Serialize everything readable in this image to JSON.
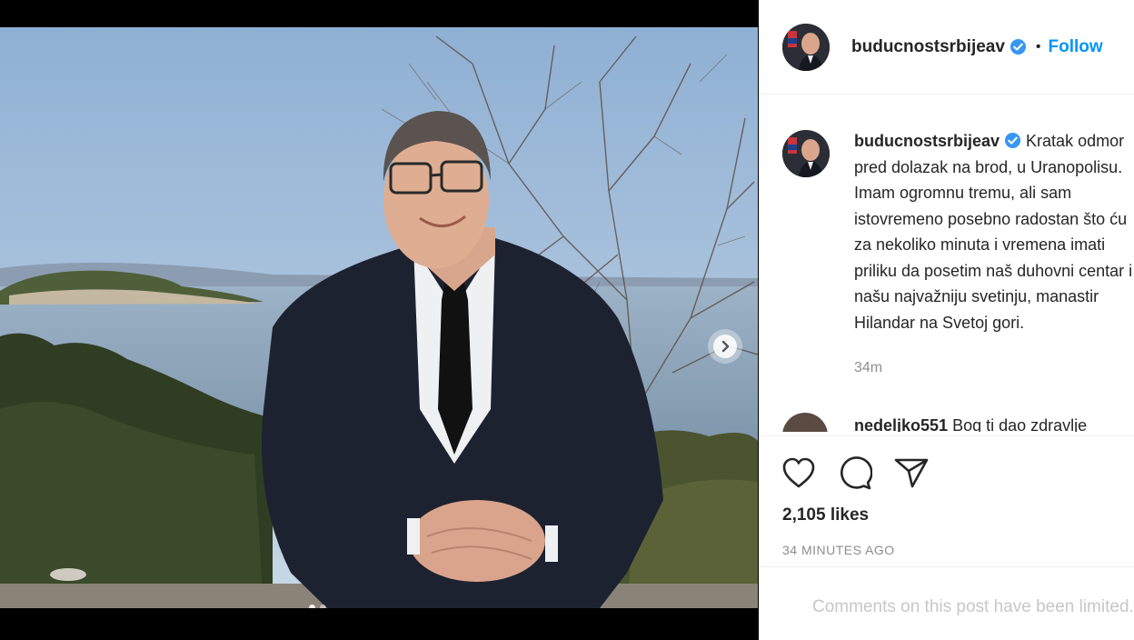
{
  "post": {
    "username": "buducnostsrbijeav",
    "follow_label": "Follow",
    "separator": "•",
    "caption": "Kratak odmor pred dolazak na brod, u Uranopolisu. Imam ogromnu tremu, ali sam istovremeno posebno radostan što ću za nekoliko minuta i vremena imati priliku da posetim naš duhovni centar i našu najvažniju svetinju, manastir Hilandar na Svetoj gori.",
    "time_ago": "34m",
    "likes": "2,105 likes",
    "posted": "34 MINUTES AGO",
    "comments_disabled": "Comments on this post have been limited."
  },
  "comment": {
    "username": "nedeljko551",
    "text": "Bog ti dao zdravlje"
  },
  "carousel": {
    "slide_count": 2,
    "active_index": 0
  },
  "icons": {
    "verified": "verified-badge-icon",
    "next": "chevron-right-icon",
    "like": "heart-icon",
    "comment": "comment-bubble-icon",
    "share": "paper-plane-icon"
  },
  "colors": {
    "link_blue": "#0095f6",
    "verified_blue": "#3897f0",
    "muted": "#8e8e8e",
    "disabled": "#c7c7c7"
  }
}
